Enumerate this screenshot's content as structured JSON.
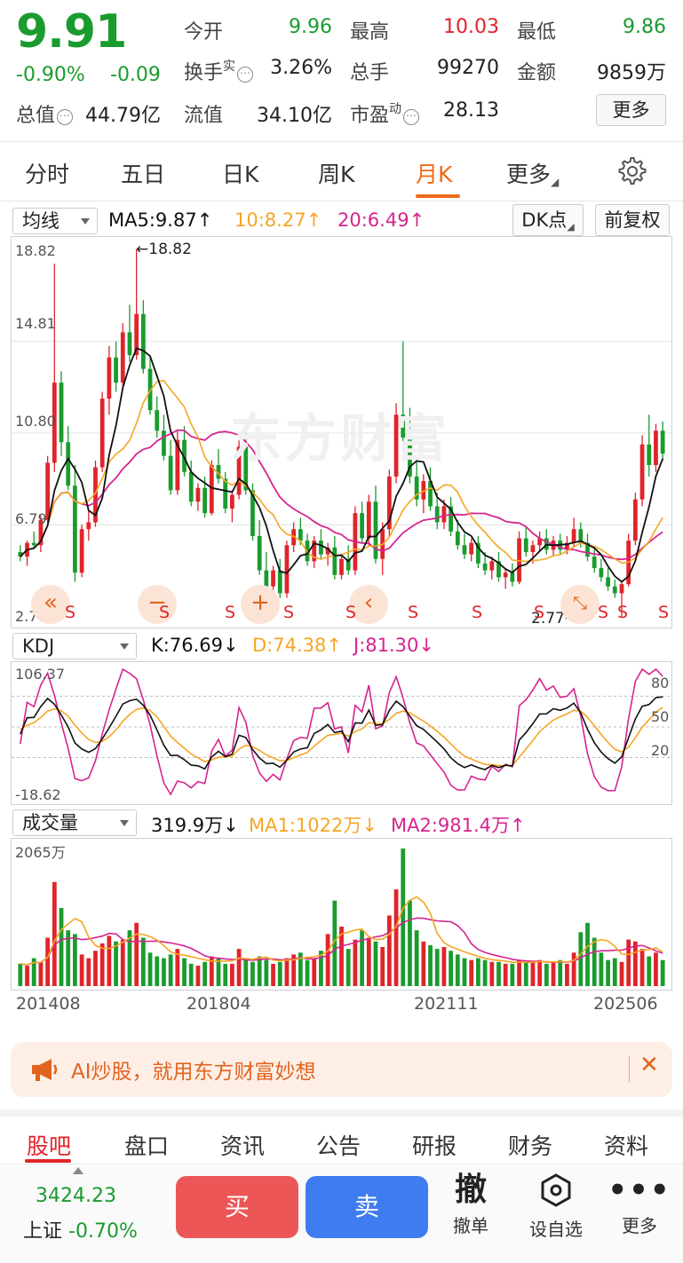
{
  "quote": {
    "price": "9.91",
    "change_pct": "-0.90%",
    "change_abs": "-0.09",
    "open_label": "今开",
    "open": "9.96",
    "high_label": "最高",
    "high": "10.03",
    "low_label": "最低",
    "low": "9.86",
    "turnover_label": "换手",
    "turnover_sup": "实",
    "turnover": "3.26%",
    "volume_label": "总手",
    "volume": "99270",
    "amount_label": "金额",
    "amount": "9859万",
    "mktcap_label": "总值",
    "mktcap": "44.79亿",
    "float_label": "流值",
    "float_cap": "34.10亿",
    "pe_label": "市盈",
    "pe_sup": "动",
    "pe": "28.13",
    "more": "更多",
    "colors": {
      "down": "#1a9b2e",
      "up": "#e0242b"
    }
  },
  "period_tabs": {
    "items": [
      "分时",
      "五日",
      "日K",
      "周K",
      "月K",
      "更多"
    ],
    "active": "月K"
  },
  "main_chart": {
    "indicator": "均线",
    "ma5": "MA5:9.87",
    "ma10": "10:8.27",
    "ma20": "20:6.49",
    "dk_button": "DK点",
    "adjust_button": "前复权",
    "y_ticks": [
      "18.82",
      "14.81",
      "10.80",
      "6.79",
      "2.77"
    ],
    "max_label": "18.82",
    "min_label": "2.77",
    "watermark": "东方财富",
    "s_marker": "S",
    "nav_prev": "«",
    "nav_zoom_out": "−",
    "nav_zoom_in": "+",
    "nav_back": "‹",
    "colors": {
      "up": "#e0242b",
      "down": "#1a9b2e",
      "ma5": "#111111",
      "ma10": "#f5a623",
      "ma20": "#d6248f"
    }
  },
  "kdj": {
    "indicator": "KDJ",
    "k": "K:76.69",
    "d": "D:74.38",
    "j": "J:81.30",
    "y_top": "106.37",
    "y_bottom": "-18.62",
    "levels": [
      "80",
      "50",
      "20"
    ]
  },
  "volume": {
    "indicator": "成交量",
    "vol": "319.9万",
    "ma1": "MA1:1022万",
    "ma2": "MA2:981.4万",
    "y_top": "2065万",
    "x_labels": [
      "201408",
      "201804",
      "202111",
      "202506"
    ]
  },
  "chart_data": {
    "type": "candlestick",
    "period": "monthly",
    "ylim": [
      2.77,
      18.82
    ],
    "x_labels": [
      "201408",
      "201804",
      "202111",
      "202506"
    ],
    "ohlc": [
      [
        5.6,
        5.9,
        5.2,
        5.4
      ],
      [
        5.4,
        6.1,
        5.0,
        6.0
      ],
      [
        6.0,
        6.5,
        5.8,
        5.9
      ],
      [
        5.9,
        7.2,
        5.6,
        7.0
      ],
      [
        7.0,
        9.8,
        6.9,
        9.5
      ],
      [
        9.5,
        18.2,
        9.1,
        13.0
      ],
      [
        13.0,
        13.5,
        9.8,
        10.4
      ],
      [
        10.4,
        11.1,
        8.3,
        8.5
      ],
      [
        8.5,
        9.4,
        4.3,
        4.7
      ],
      [
        4.7,
        6.8,
        4.5,
        6.6
      ],
      [
        6.6,
        7.4,
        6.1,
        6.9
      ],
      [
        6.9,
        9.6,
        6.7,
        9.3
      ],
      [
        9.3,
        12.6,
        9.1,
        12.3
      ],
      [
        12.3,
        14.6,
        11.6,
        14.1
      ],
      [
        14.1,
        14.8,
        12.6,
        13.0
      ],
      [
        13.0,
        15.6,
        12.8,
        15.2
      ],
      [
        15.2,
        16.4,
        13.9,
        14.2
      ],
      [
        14.2,
        18.82,
        14.0,
        16.0
      ],
      [
        16.0,
        16.6,
        13.4,
        13.6
      ],
      [
        13.6,
        14.1,
        11.6,
        11.8
      ],
      [
        11.8,
        12.4,
        10.6,
        10.9
      ],
      [
        10.9,
        11.6,
        9.6,
        9.8
      ],
      [
        9.8,
        10.5,
        8.1,
        8.3
      ],
      [
        8.3,
        10.9,
        8.1,
        10.5
      ],
      [
        10.5,
        11.1,
        8.9,
        9.1
      ],
      [
        9.1,
        9.6,
        7.6,
        7.8
      ],
      [
        7.8,
        8.6,
        7.4,
        8.4
      ],
      [
        8.4,
        8.9,
        7.1,
        7.3
      ],
      [
        7.3,
        9.6,
        7.2,
        9.4
      ],
      [
        9.4,
        10.1,
        8.6,
        8.8
      ],
      [
        8.8,
        9.1,
        7.3,
        7.5
      ],
      [
        7.5,
        8.3,
        6.9,
        8.1
      ],
      [
        8.1,
        10.6,
        7.9,
        10.2
      ],
      [
        10.2,
        10.9,
        8.1,
        8.3
      ],
      [
        8.3,
        8.6,
        6.1,
        6.3
      ],
      [
        6.3,
        7.0,
        4.6,
        4.8
      ],
      [
        4.8,
        5.6,
        3.9,
        4.1
      ],
      [
        4.1,
        5.0,
        3.7,
        4.8
      ],
      [
        4.8,
        5.3,
        3.6,
        3.8
      ],
      [
        3.8,
        6.1,
        3.6,
        5.9
      ],
      [
        5.9,
        6.9,
        5.6,
        6.6
      ],
      [
        6.6,
        7.1,
        5.9,
        6.1
      ],
      [
        6.1,
        6.4,
        5.0,
        5.2
      ],
      [
        5.2,
        6.3,
        4.9,
        6.1
      ],
      [
        6.1,
        6.6,
        5.3,
        5.5
      ],
      [
        5.5,
        6.0,
        5.0,
        5.8
      ],
      [
        5.8,
        6.3,
        4.4,
        4.6
      ],
      [
        4.6,
        5.5,
        4.4,
        5.3
      ],
      [
        5.3,
        5.9,
        4.6,
        4.8
      ],
      [
        4.8,
        7.6,
        4.6,
        7.3
      ],
      [
        7.3,
        7.8,
        6.0,
        6.2
      ],
      [
        6.2,
        8.1,
        5.9,
        7.8
      ],
      [
        7.8,
        8.5,
        5.1,
        5.3
      ],
      [
        5.3,
        6.9,
        4.6,
        6.6
      ],
      [
        6.6,
        9.2,
        6.3,
        8.9
      ],
      [
        8.9,
        12.1,
        8.6,
        11.6
      ],
      [
        11.6,
        14.8,
        10.2,
        10.6
      ],
      [
        10.6,
        11.9,
        8.6,
        8.9
      ],
      [
        8.9,
        9.6,
        7.6,
        7.9
      ],
      [
        7.9,
        9.0,
        7.3,
        8.7
      ],
      [
        8.7,
        9.3,
        7.4,
        7.6
      ],
      [
        7.6,
        8.2,
        6.6,
        6.9
      ],
      [
        6.9,
        7.9,
        6.6,
        7.6
      ],
      [
        7.6,
        8.0,
        6.3,
        6.5
      ],
      [
        6.5,
        7.0,
        5.7,
        5.9
      ],
      [
        5.9,
        6.4,
        5.3,
        5.5
      ],
      [
        5.5,
        6.2,
        5.2,
        6.0
      ],
      [
        6.0,
        6.3,
        4.9,
        5.1
      ],
      [
        5.1,
        5.6,
        4.6,
        4.8
      ],
      [
        4.8,
        5.4,
        4.4,
        5.2
      ],
      [
        5.2,
        5.6,
        4.3,
        4.5
      ],
      [
        4.5,
        4.9,
        4.0,
        4.7
      ],
      [
        4.7,
        5.1,
        4.1,
        4.3
      ],
      [
        4.3,
        6.5,
        4.2,
        6.2
      ],
      [
        6.2,
        6.7,
        5.4,
        5.6
      ],
      [
        5.6,
        6.1,
        5.1,
        5.9
      ],
      [
        5.9,
        6.5,
        5.6,
        6.2
      ],
      [
        6.2,
        6.6,
        5.5,
        5.7
      ],
      [
        5.7,
        6.3,
        5.4,
        6.1
      ],
      [
        6.1,
        6.4,
        5.5,
        5.7
      ],
      [
        5.7,
        6.3,
        5.5,
        6.0
      ],
      [
        6.0,
        7.1,
        5.8,
        6.6
      ],
      [
        6.6,
        6.9,
        5.8,
        6.0
      ],
      [
        6.0,
        6.4,
        5.2,
        5.4
      ],
      [
        5.4,
        5.8,
        4.7,
        4.9
      ],
      [
        4.9,
        5.3,
        4.3,
        4.5
      ],
      [
        4.5,
        4.9,
        3.9,
        4.1
      ],
      [
        4.1,
        4.4,
        3.6,
        3.8
      ],
      [
        3.8,
        4.3,
        2.77,
        4.2
      ],
      [
        4.2,
        6.4,
        4.1,
        6.1
      ],
      [
        6.1,
        8.2,
        5.9,
        7.9
      ],
      [
        7.9,
        10.7,
        7.6,
        10.3
      ],
      [
        10.3,
        11.6,
        8.9,
        9.4
      ],
      [
        9.4,
        11.2,
        9.1,
        10.9
      ],
      [
        10.9,
        11.3,
        9.6,
        9.9
      ]
    ],
    "volume": [
      120,
      110,
      150,
      130,
      260,
      560,
      420,
      300,
      280,
      170,
      150,
      190,
      230,
      270,
      240,
      250,
      300,
      340,
      260,
      180,
      160,
      150,
      170,
      200,
      150,
      120,
      110,
      130,
      160,
      150,
      120,
      120,
      200,
      150,
      130,
      160,
      140,
      120,
      130,
      150,
      170,
      180,
      140,
      150,
      190,
      280,
      460,
      320,
      200,
      250,
      300,
      260,
      240,
      210,
      380,
      520,
      740,
      460,
      300,
      240,
      220,
      200,
      210,
      190,
      170,
      150,
      140,
      150,
      140,
      130,
      130,
      120,
      120,
      140,
      130,
      130,
      140,
      120,
      130,
      140,
      120,
      180,
      290,
      340,
      260,
      180,
      140,
      150,
      130,
      250,
      240,
      200,
      160,
      180,
      140
    ]
  },
  "banner": {
    "text": "AI炒股，就用东方财富妙想"
  },
  "content_tabs": {
    "items": [
      "股吧",
      "盘口",
      "资讯",
      "公告",
      "研报",
      "财务",
      "资料"
    ],
    "active": "股吧"
  },
  "footer": {
    "index_value": "3424.23",
    "index_name": "上证",
    "index_change": "-0.70%",
    "buy": "买",
    "sell": "卖",
    "cancel_glyph": "撤",
    "cancel_label": "撤单",
    "watchlist_label": "设自选",
    "more_label": "更多"
  }
}
